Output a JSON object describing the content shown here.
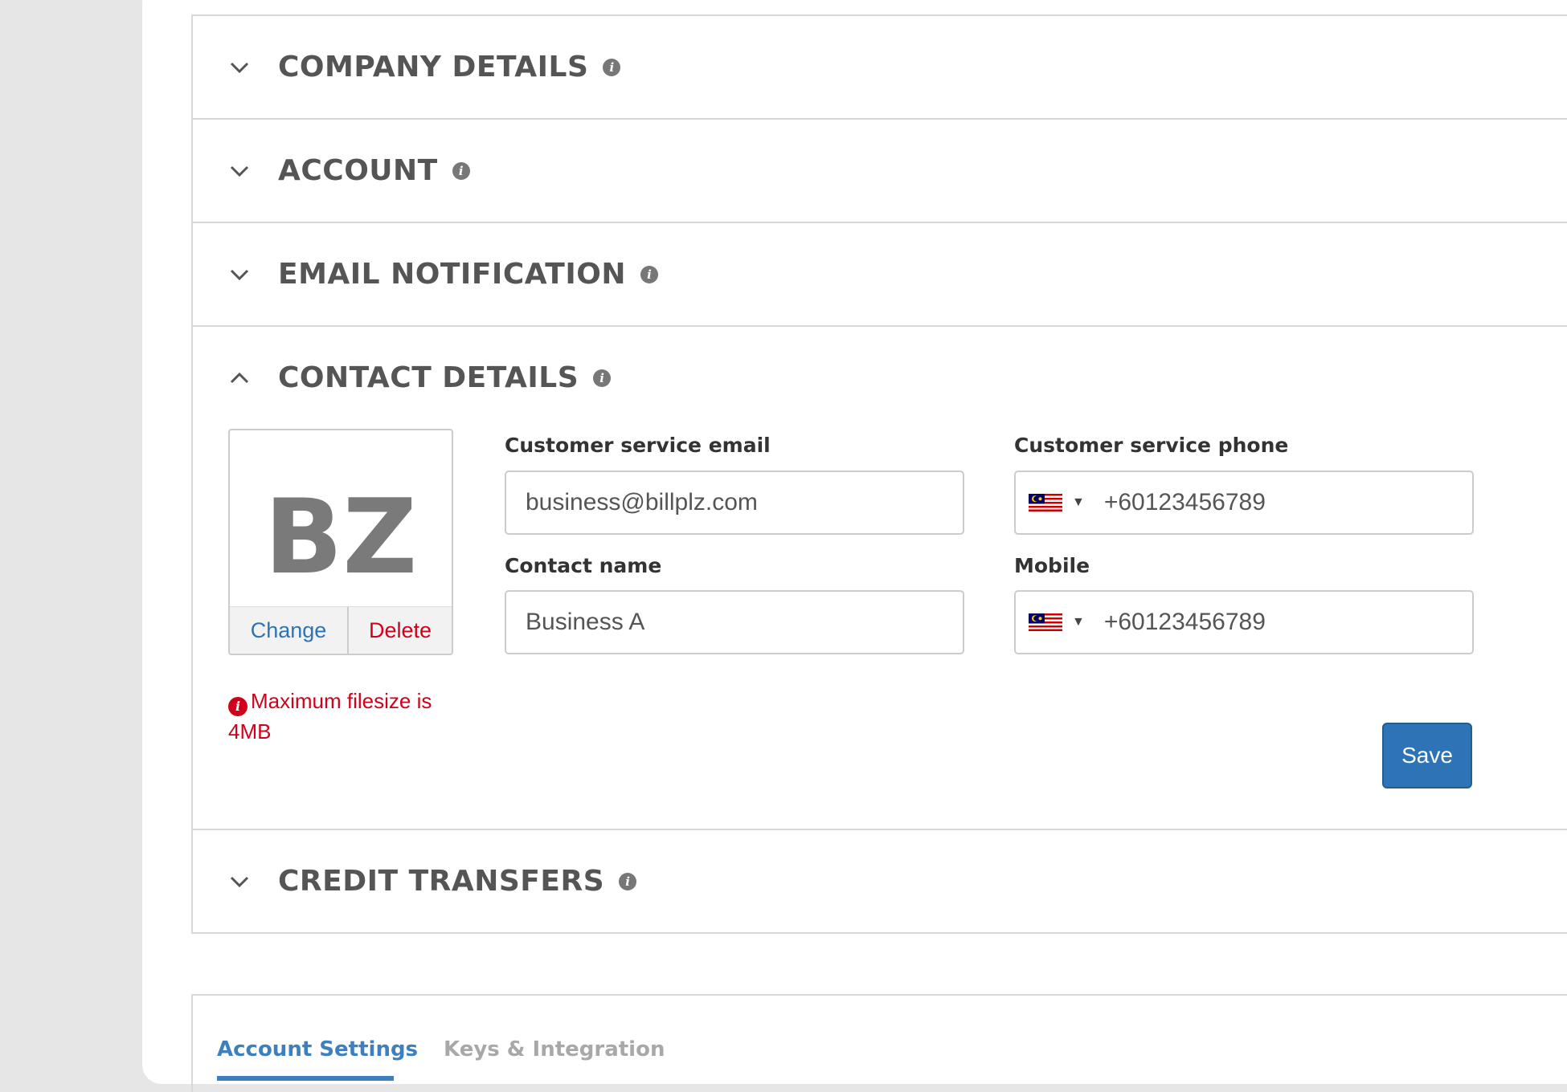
{
  "sections": [
    {
      "title": "COMPANY DETAILS",
      "expanded": false
    },
    {
      "title": "ACCOUNT",
      "expanded": false
    },
    {
      "title": "EMAIL NOTIFICATION",
      "expanded": false
    },
    {
      "title": "CONTACT DETAILS",
      "expanded": true
    },
    {
      "title": "CREDIT TRANSFERS",
      "expanded": false
    }
  ],
  "contact": {
    "avatar_initials": "BZ",
    "change_label": "Change",
    "delete_label": "Delete",
    "error_text": "Maximum filesize is 4MB",
    "email_label": "Customer service email",
    "email_value": "business@billplz.com",
    "phone_label": "Customer service phone",
    "phone_value": "+60123456789",
    "name_label": "Contact name",
    "name_value": "Business A",
    "mobile_label": "Mobile",
    "mobile_value": "+60123456789",
    "save_label": "Save",
    "country_flag": "malaysia-flag"
  },
  "tabs": [
    {
      "label": "Account Settings",
      "active": true
    },
    {
      "label": "Keys & Integration",
      "active": false
    }
  ],
  "colors": {
    "primary": "#2d73b5",
    "error": "#d0021b",
    "tab_active": "#3d7fbf",
    "tab_inactive": "#a8a8a8"
  }
}
